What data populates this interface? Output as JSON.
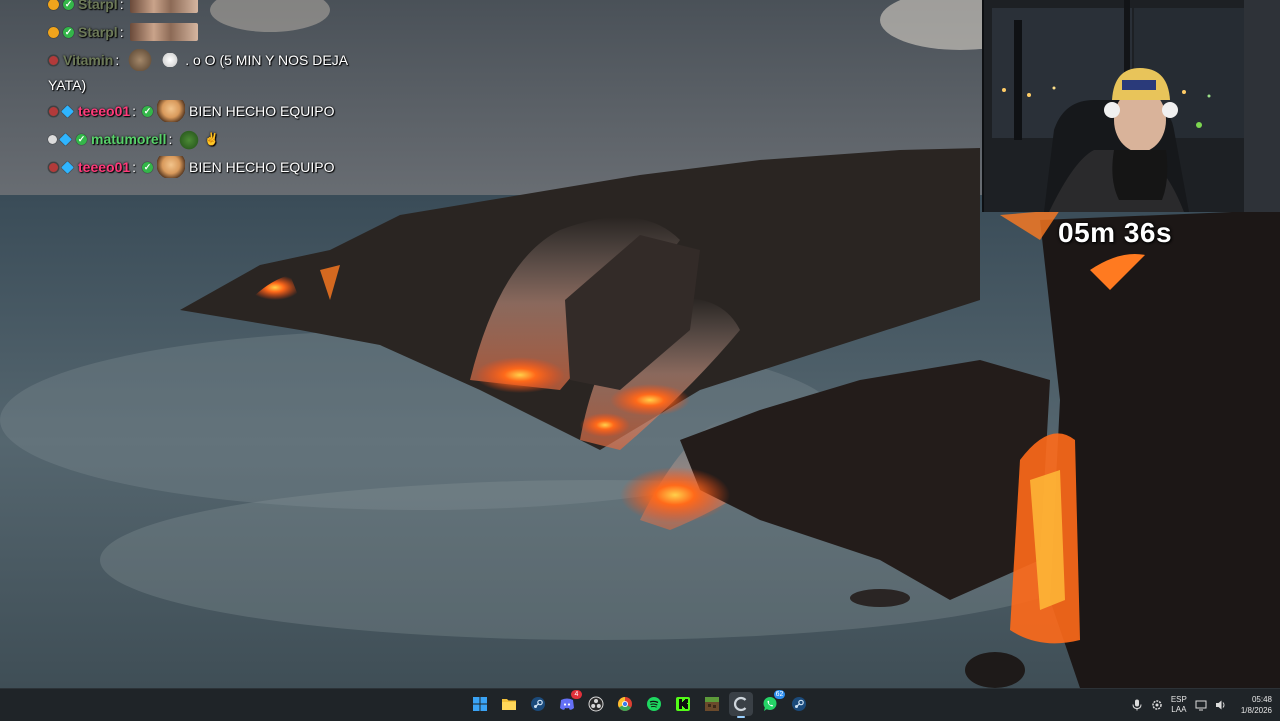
{
  "chat": {
    "messages": [
      {
        "user": "Starpl",
        "badges": [
          "orange",
          "check"
        ],
        "text": "",
        "emotes": [
          "wide"
        ]
      },
      {
        "user": "Starpl",
        "badges": [
          "orange",
          "check"
        ],
        "text": "",
        "emotes": [
          "wide"
        ]
      },
      {
        "user": "Vitamin",
        "badges": [
          "red"
        ],
        "text": ". o O (5 MIN Y NOS DEJA",
        "text_cont": "YATA)",
        "emotes": [
          "dog",
          "white"
        ]
      },
      {
        "user": "teeeo01",
        "badges": [
          "red",
          "diamond",
          "check"
        ],
        "text": "BIEN HECHO EQUIPO",
        "emotes": [
          "face"
        ]
      },
      {
        "user": "matumorell",
        "badges": [
          "grey",
          "diamond",
          "check"
        ],
        "text": "",
        "emotes": [
          "pepe",
          "hand"
        ]
      },
      {
        "user": "teeeo01",
        "badges": [
          "red",
          "diamond",
          "check"
        ],
        "text": "BIEN HECHO EQUIPO",
        "emotes": [
          "face"
        ]
      }
    ],
    "separator": ":"
  },
  "timer": {
    "text": "05m 36s"
  },
  "taskbar": {
    "apps": [
      {
        "name": "start",
        "icon": "windows-icon"
      },
      {
        "name": "file-explorer",
        "icon": "folder-icon"
      },
      {
        "name": "steam",
        "icon": "steam-icon"
      },
      {
        "name": "discord",
        "icon": "discord-icon",
        "badge": "4"
      },
      {
        "name": "obs",
        "icon": "obs-icon"
      },
      {
        "name": "chrome",
        "icon": "chrome-icon"
      },
      {
        "name": "spotify",
        "icon": "spotify-icon"
      },
      {
        "name": "kick",
        "icon": "kick-icon"
      },
      {
        "name": "minecraft",
        "icon": "minecraft-icon"
      },
      {
        "name": "active-app",
        "icon": "c-icon",
        "active": true
      },
      {
        "name": "whatsapp",
        "icon": "whatsapp-icon",
        "badge": "62"
      },
      {
        "name": "steam-2",
        "icon": "steam-icon"
      }
    ],
    "tray": {
      "language": "ESP",
      "layout": "LAA",
      "time": "05:48",
      "date": "1/8/2026"
    }
  },
  "colors": {
    "taskbar": "#1f2428",
    "lava": "#ff6a1a",
    "username_pink": "#ff3a7a",
    "username_green": "#58d16a"
  }
}
